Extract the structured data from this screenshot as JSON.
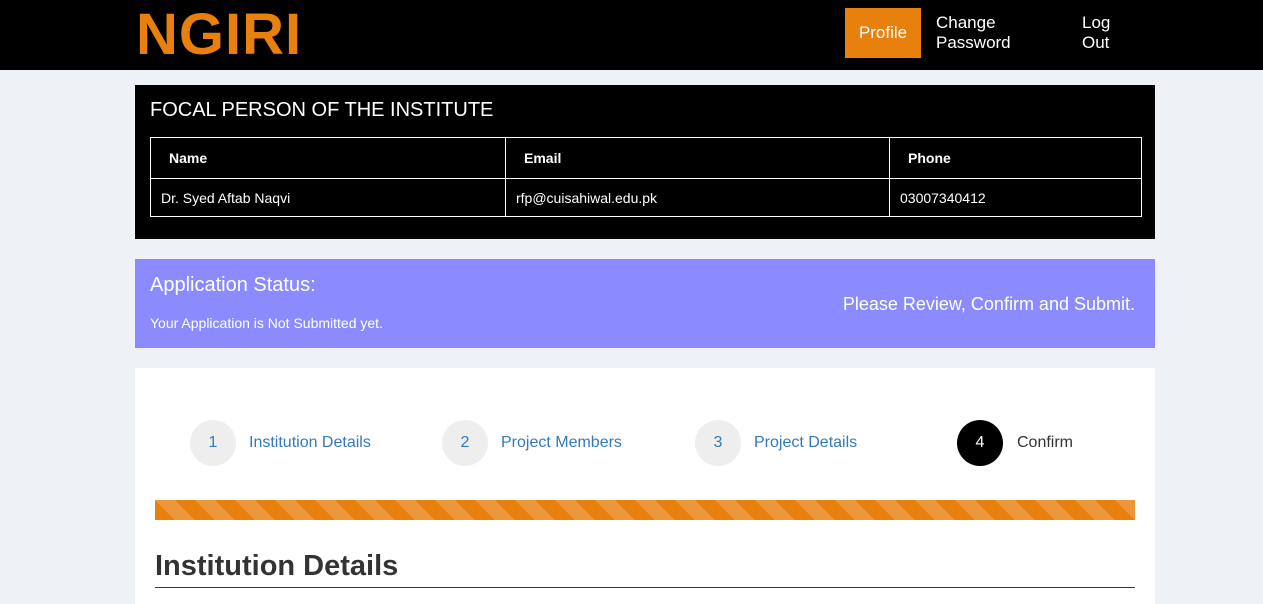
{
  "header": {
    "logo": "NGIRI",
    "nav": {
      "profile": "Profile",
      "change_password": "Change Password",
      "log_out": "Log Out"
    }
  },
  "focal_person": {
    "title": "FOCAL PERSON OF THE INSTITUTE",
    "columns": [
      "Name",
      "Email",
      "Phone"
    ],
    "row": [
      "Dr. Syed Aftab Naqvi",
      "rfp@cuisahiwal.edu.pk",
      "03007340412"
    ]
  },
  "application_status": {
    "title": "Application Status:",
    "subtitle": "Your Application is Not Submitted yet.",
    "message": "Please Review, Confirm and Submit."
  },
  "wizard": {
    "steps": [
      {
        "number": "1",
        "label": "Institution Details"
      },
      {
        "number": "2",
        "label": "Project Members"
      },
      {
        "number": "3",
        "label": "Project Details"
      },
      {
        "number": "4",
        "label": "Confirm"
      }
    ],
    "active_step": 4,
    "progress_percent": 100,
    "section_title": "Institution Details"
  },
  "colors": {
    "accent": "#e8800e",
    "status_bg": "#8b8bff",
    "link": "#337ab7"
  }
}
